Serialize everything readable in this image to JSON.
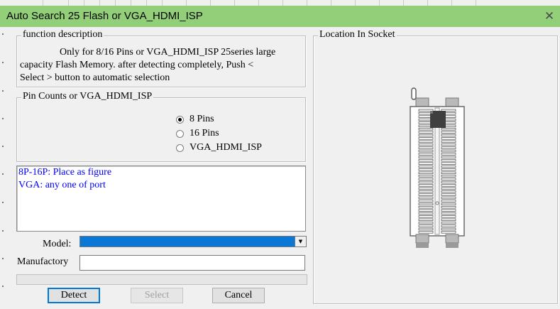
{
  "window": {
    "title": "Auto Search 25 Flash or VGA_HDMI_ISP",
    "close_glyph": "✕"
  },
  "function_description": {
    "legend": "function description",
    "lines": [
      "Only for 8/16 Pins or VGA_HDMI_ISP 25series large",
      "capacity Flash Memory. after detecting completely, Push <",
      "Select > button to automatic selection"
    ]
  },
  "pin_counts": {
    "legend": "Pin Counts or VGA_HDMI_ISP",
    "options": [
      {
        "label": "8 Pins",
        "checked": true
      },
      {
        "label": "16 Pins",
        "checked": false
      },
      {
        "label": "VGA_HDMI_ISP",
        "checked": false
      }
    ]
  },
  "info_memo": {
    "lines": [
      "8P-16P: Place as figure",
      "VGA: any one of port"
    ],
    "text_color": "#0000ff"
  },
  "model": {
    "label": "Model:",
    "value": "",
    "highlight_color": "#0a78d7"
  },
  "manufactory": {
    "label": "Manufactory",
    "value": ""
  },
  "progress": {
    "value": 0
  },
  "buttons": {
    "detect": "Detect",
    "select": "Select",
    "cancel": "Cancel"
  },
  "socket": {
    "legend": "Location In Socket"
  },
  "colors": {
    "titlebar": "#93cf79",
    "background": "#f0f0f0"
  }
}
